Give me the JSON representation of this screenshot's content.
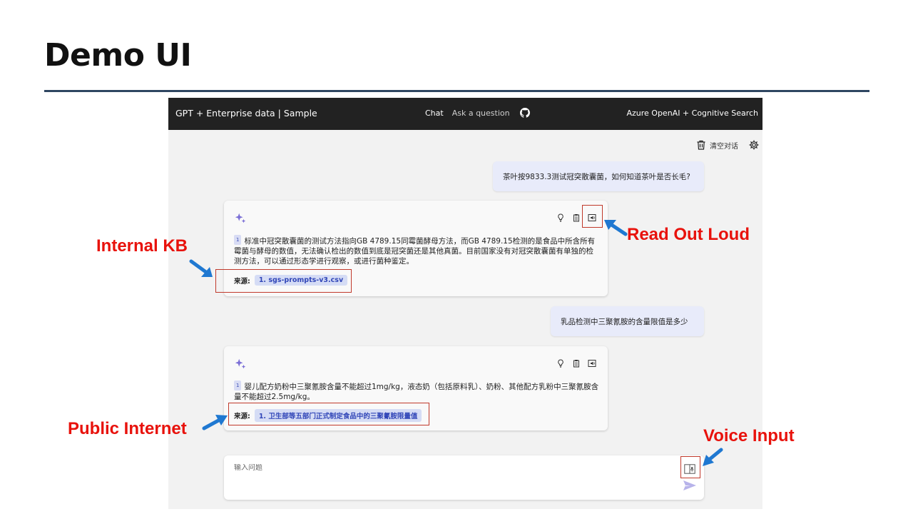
{
  "slide": {
    "title": "Demo UI"
  },
  "app": {
    "brand": "GPT + Enterprise data | Sample",
    "nav": {
      "chat": "Chat",
      "ask": "Ask a question",
      "github_icon": "github-icon"
    },
    "top_right": "Azure OpenAI + Cognitive Search",
    "toolbar": {
      "clear_label": "清空对话",
      "clear_icon": "trash-icon",
      "settings_icon": "gear-icon"
    },
    "conversation": [
      {
        "question": "茶叶按9833.3测试冠突散囊菌，如何知道茶叶是否长毛?",
        "answer": {
          "citation_num": "1",
          "text": "标准中冠突散囊菌的测试方法指向GB 4789.15同霉菌酵母方法，而GB 4789.15检测的是食品中所含所有霉菌与酵母的数值，无法确认检出的数值到底是冠突菌还是其他真菌。目前国家没有对冠突散囊菌有单独的检测方法，可以通过形态学进行观察，或进行菌种鉴定。",
          "sources_label": "来源:",
          "source": "1. sgs-prompts-v3.csv"
        }
      },
      {
        "question": "乳品检测中三聚氰胺的含量限值是多少",
        "answer": {
          "citation_num": "1",
          "text": "婴儿配方奶粉中三聚氰胺含量不能超过1mg/kg，液态奶（包括原料乳）、奶粉、其他配方乳粉中三聚氰胺含量不能超过2.5mg/kg。",
          "sources_label": "来源:",
          "source": "1. 卫生部等五部门正式制定食品中的三聚氰胺限量值"
        }
      }
    ],
    "input": {
      "placeholder": "输入问题",
      "value": ""
    }
  },
  "callouts": {
    "internal_kb": "Internal KB",
    "read_out_loud": "Read Out Loud",
    "public_internet": "Public Internet",
    "voice_input": "Voice Input"
  },
  "colors": {
    "callout_red": "#e8120c",
    "arrow_blue": "#1f78d1",
    "topbar": "#222222",
    "accent": "#3146b8"
  }
}
